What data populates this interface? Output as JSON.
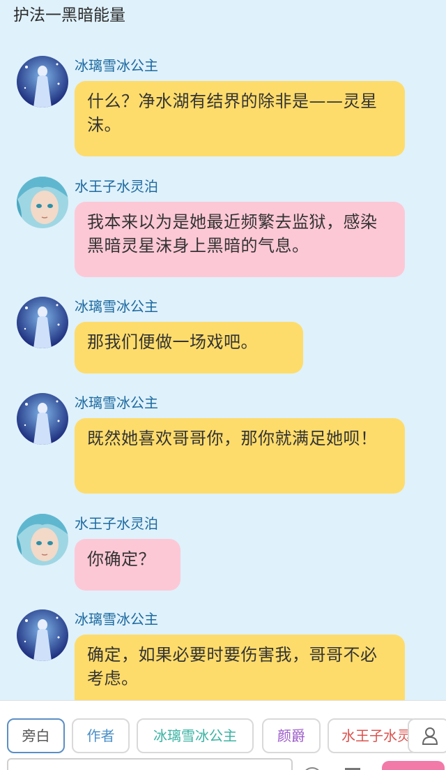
{
  "header": {
    "title": "护法一黑暗能量"
  },
  "messages": [
    {
      "sender": "冰璃雪冰公主",
      "avatar": "princess-avatar",
      "color": "yellow",
      "text": "什么？净水湖有结界的除非是——灵星沫。"
    },
    {
      "sender": "水王子水灵泊",
      "avatar": "prince-avatar",
      "color": "pink",
      "text": "我本来以为是她最近频繁去监狱，感染黑暗灵星沫身上黑暗的气息。"
    },
    {
      "sender": "冰璃雪冰公主",
      "avatar": "princess-avatar",
      "color": "yellow",
      "text": "那我们便做一场戏吧。"
    },
    {
      "sender": "冰璃雪冰公主",
      "avatar": "princess-avatar",
      "color": "yellow",
      "text": "既然她喜欢哥哥你，那你就满足她呗！"
    },
    {
      "sender": "水王子水灵泊",
      "avatar": "prince-avatar",
      "color": "pink",
      "text": "你确定？"
    },
    {
      "sender": "冰璃雪冰公主",
      "avatar": "princess-avatar",
      "color": "yellow",
      "text": "确定，如果必要时要伤害我，哥哥不必考虑。"
    }
  ],
  "roles": [
    {
      "label": "旁白",
      "color": "#555555",
      "active": true
    },
    {
      "label": "作者",
      "color": "#4a8fc7",
      "active": false
    },
    {
      "label": "冰璃雪冰公主",
      "color": "#3bb3a3",
      "active": false
    },
    {
      "label": "颜爵",
      "color": "#9b59c9",
      "active": false
    },
    {
      "label": "水王子水灵泊",
      "color": "#d9534f",
      "active": false
    }
  ],
  "icons": {
    "person": "person-icon",
    "send": "send-button"
  }
}
